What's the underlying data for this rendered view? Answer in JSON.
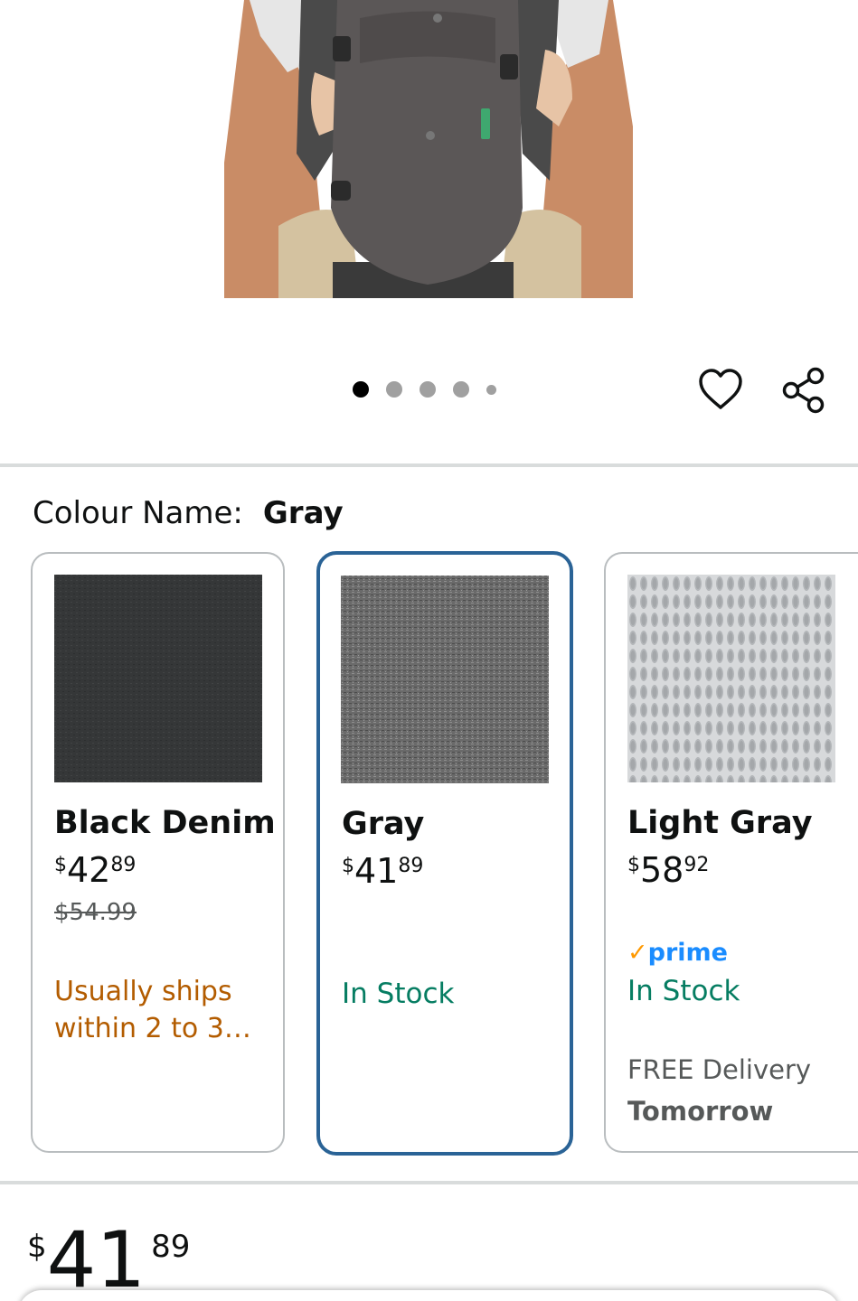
{
  "gallery": {
    "dots_count": 5,
    "active_index": 0
  },
  "actions": {
    "wishlist_icon": "heart-icon",
    "share_icon": "share-icon"
  },
  "colour": {
    "label": "Colour Name:",
    "selected": "Gray"
  },
  "variants": [
    {
      "name": "Black Denim",
      "price_currency": "$",
      "price_whole": "42",
      "price_fraction": "89",
      "list_price": "$54.99",
      "availability": "Usually ships within 2 to 3…",
      "availability_color": "#b35c00",
      "swatch_color": "#353738"
    },
    {
      "name": "Gray",
      "price_currency": "$",
      "price_whole": "41",
      "price_fraction": "89",
      "availability": "In Stock",
      "availability_color": "#067d62",
      "selected": true,
      "swatch_color": "#6f6f6f"
    },
    {
      "name": "Light Gray",
      "price_currency": "$",
      "price_whole": "58",
      "price_fraction": "92",
      "badge": "prime",
      "availability": "In Stock",
      "availability_color": "#067d62",
      "delivery_label": "FREE Delivery",
      "delivery_day": "Tomorrow",
      "swatch_color": "#c6c8ca"
    }
  ],
  "price": {
    "currency": "$",
    "whole": "41",
    "fraction": "89"
  },
  "colors": {
    "selected_border": "#2a6396",
    "in_stock": "#067d62",
    "ships_later": "#b35c00",
    "prime_blue": "#1a8cff",
    "prime_check": "#ff9900"
  }
}
